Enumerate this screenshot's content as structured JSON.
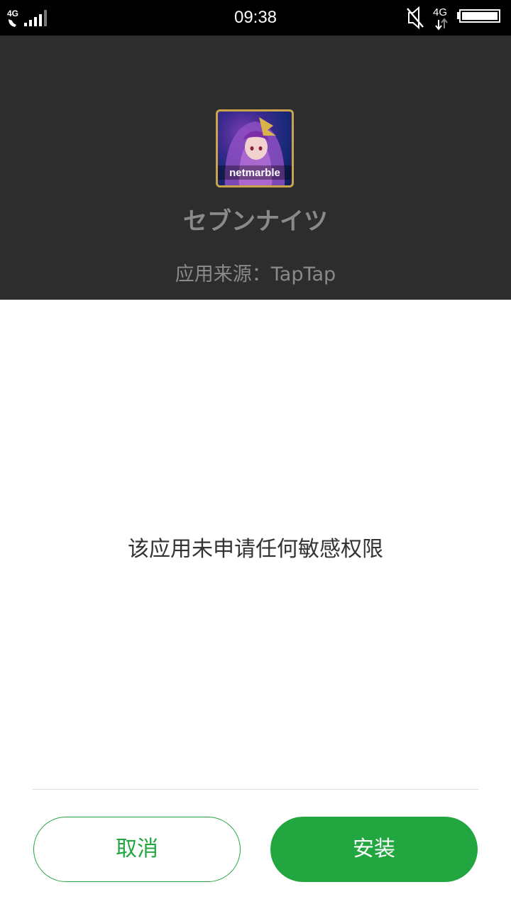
{
  "status_bar": {
    "left_network": "4G",
    "time": "09:38",
    "right_network": "4G"
  },
  "app": {
    "icon_brand_text": "netmarble",
    "name": "セブンナイツ",
    "source_label": "应用来源：TapTap"
  },
  "permissions": {
    "message": "该应用未申请任何敏感权限"
  },
  "actions": {
    "cancel_label": "取消",
    "install_label": "安装"
  },
  "colors": {
    "accent": "#22a63f",
    "header_bg": "#2d2d2d",
    "status_bg": "#000000"
  }
}
